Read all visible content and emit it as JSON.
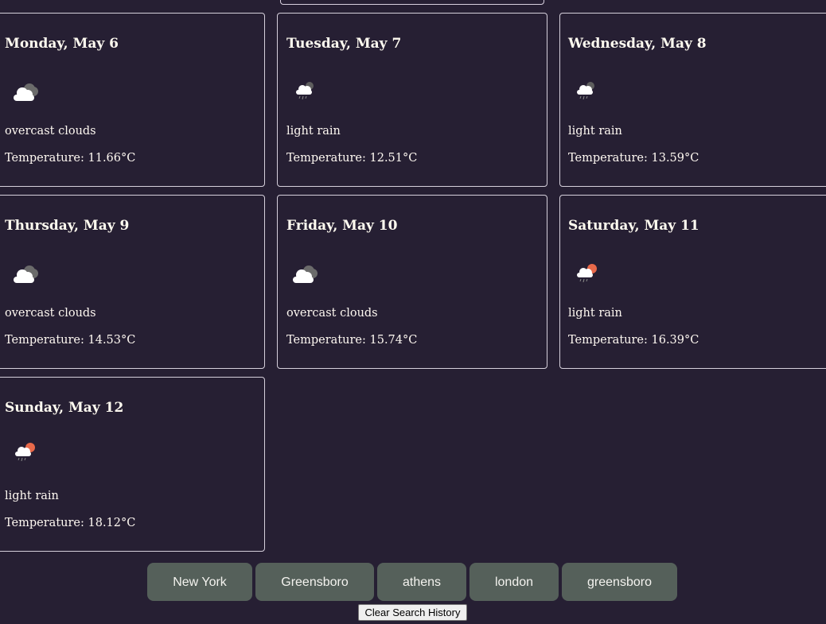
{
  "forecast": {
    "days": [
      {
        "day": "Monday, May 6",
        "icon": "overcast-clouds-icon",
        "description": "overcast clouds",
        "temperature": "Temperature: 11.66°C"
      },
      {
        "day": "Tuesday, May 7",
        "icon": "light-rain-night-icon",
        "description": "light rain",
        "temperature": "Temperature: 12.51°C"
      },
      {
        "day": "Wednesday, May 8",
        "icon": "light-rain-night-icon",
        "description": "light rain",
        "temperature": "Temperature: 13.59°C"
      },
      {
        "day": "Thursday, May 9",
        "icon": "overcast-clouds-icon",
        "description": "overcast clouds",
        "temperature": "Temperature: 14.53°C"
      },
      {
        "day": "Friday, May 10",
        "icon": "overcast-clouds-icon",
        "description": "overcast clouds",
        "temperature": "Temperature: 15.74°C"
      },
      {
        "day": "Saturday, May 11",
        "icon": "light-rain-sun-icon",
        "description": "light rain",
        "temperature": "Temperature: 16.39°C"
      },
      {
        "day": "Sunday, May 12",
        "icon": "light-rain-sun-icon",
        "description": "light rain",
        "temperature": "Temperature: 18.12°C"
      }
    ]
  },
  "history": {
    "items": [
      "New York",
      "Greensboro",
      "athens",
      "london",
      "greensboro"
    ],
    "clear_label": "Clear Search History"
  },
  "colors": {
    "background": "#261f33",
    "card_border": "#d6d0dc",
    "history_button": "#55605a",
    "sun": "#e8694a"
  }
}
